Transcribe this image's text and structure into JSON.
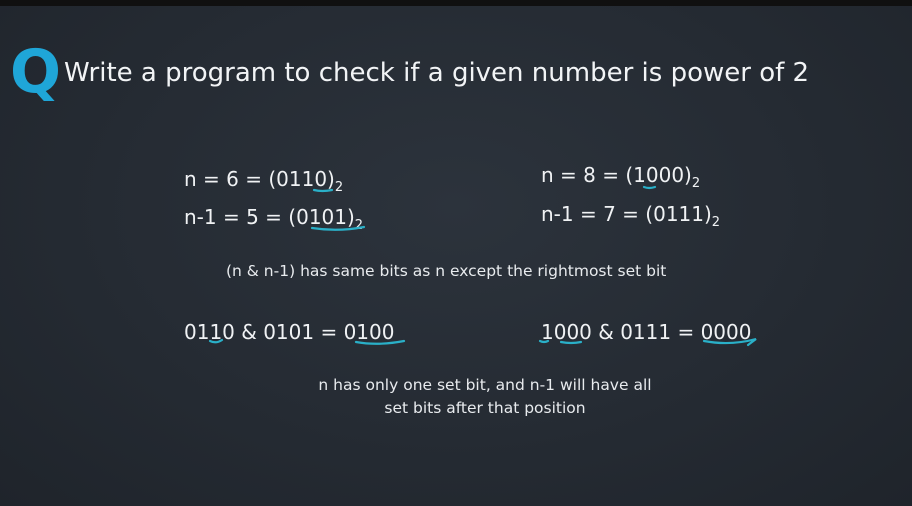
{
  "question": {
    "letter": "Q",
    "text": "Write a program to check if a given number is power of 2"
  },
  "examples": {
    "left": {
      "n_line": "n  =  6 = (0110)",
      "n_base": "2",
      "nm1_line": "n-1  =  5 = (0101)",
      "nm1_base": "2"
    },
    "right": {
      "n_line": "n  =  8 = (1000)",
      "n_base": "2",
      "nm1_line": "n-1  =  7 = (0111)",
      "nm1_base": "2"
    }
  },
  "rule_text": "(n & n-1) has same bits as n except the rightmost set bit",
  "and_results": {
    "left": "0110 & 0101 = 0100",
    "right": "1000 & 0111 = 0000"
  },
  "conclusion": {
    "line1": "n has only one set bit, and n-1 will have all",
    "line2": "set bits after that position"
  },
  "colors": {
    "accent": "#1fa6d8",
    "annotation": "#2ab0c8",
    "background": "#262c34"
  }
}
